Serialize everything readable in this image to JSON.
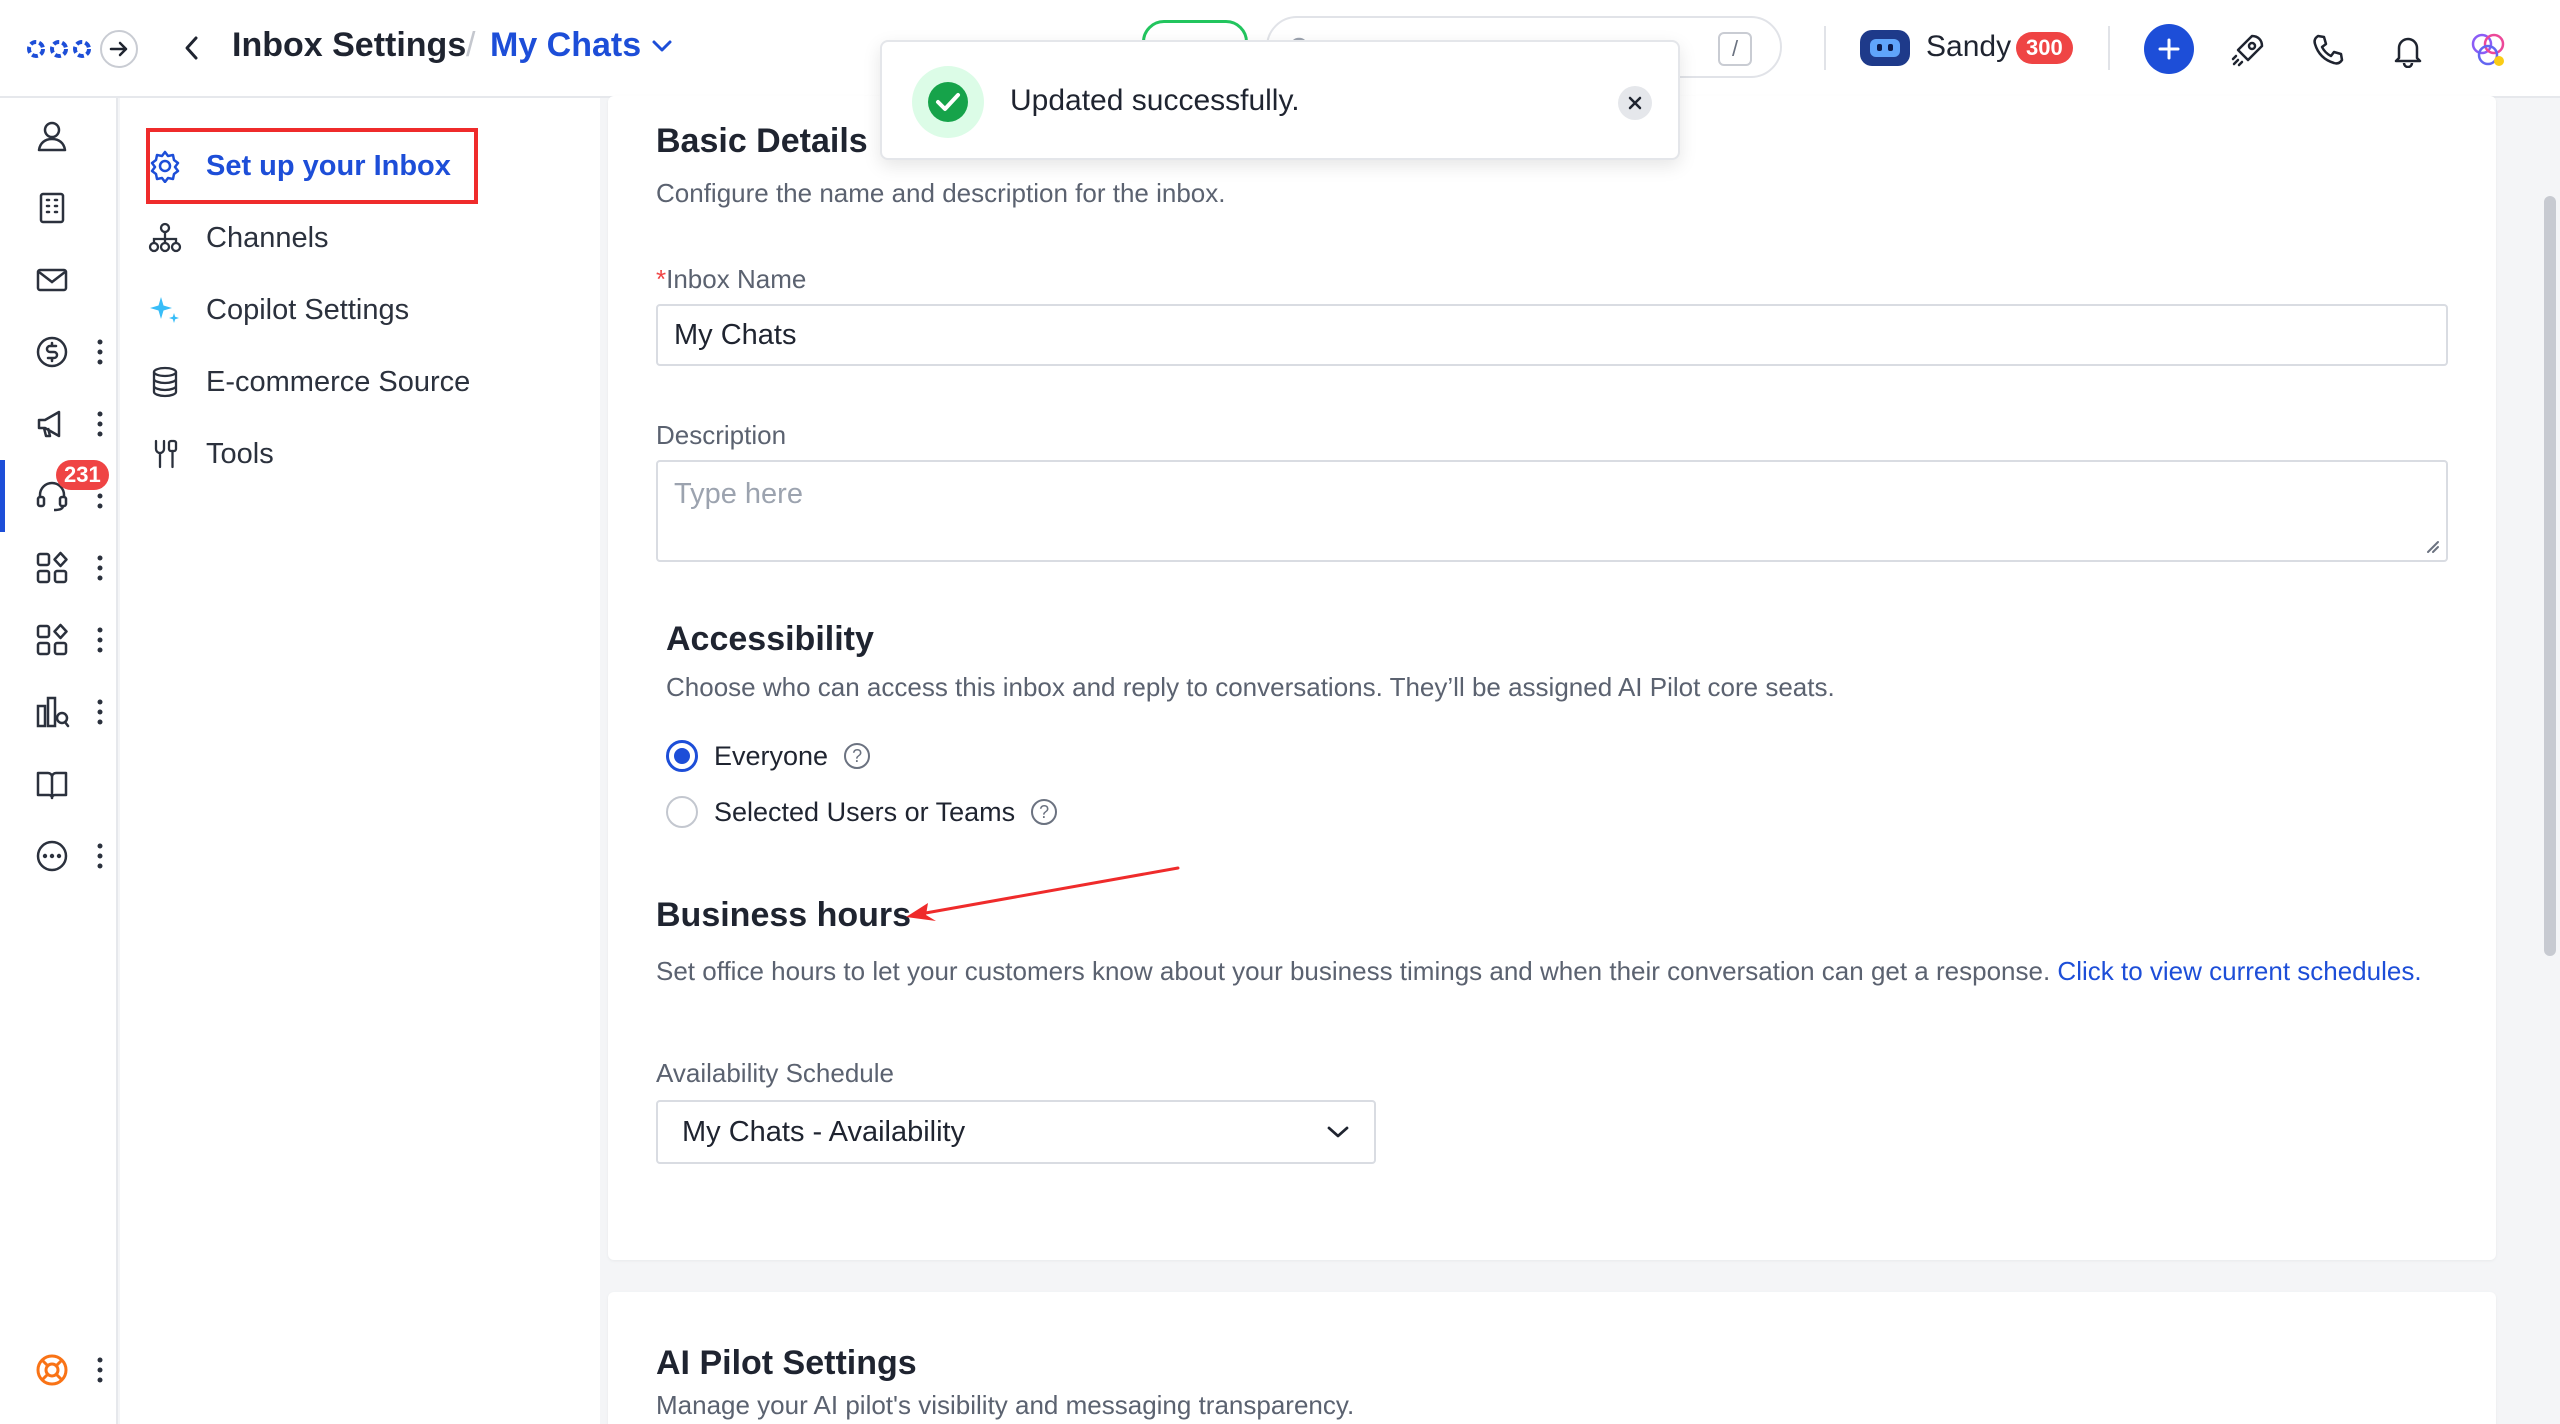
{
  "header": {
    "title": "Inbox Settings",
    "separator": "/",
    "current_inbox": "My Chats",
    "search_shortcut": "/",
    "user_name": "Sandy",
    "credits": "300"
  },
  "toast": {
    "message": "Updated successfully."
  },
  "rail": {
    "badge_count": "231"
  },
  "settings_nav": {
    "items": [
      {
        "label": "Set up your Inbox",
        "icon": "gear-icon"
      },
      {
        "label": "Channels",
        "icon": "channels-icon"
      },
      {
        "label": "Copilot Settings",
        "icon": "sparkle-icon"
      },
      {
        "label": "E-commerce Source",
        "icon": "database-icon"
      },
      {
        "label": "Tools",
        "icon": "tools-icon"
      }
    ]
  },
  "basic_details": {
    "title": "Basic Details",
    "description": "Configure the name and description for the inbox.",
    "inbox_name_required": "*",
    "inbox_name_label": "Inbox Name",
    "inbox_name_value": "My Chats",
    "description_label": "Description",
    "description_placeholder": "Type here"
  },
  "accessibility": {
    "title": "Accessibility",
    "description": "Choose who can access this inbox and reply to conversations. They’ll be assigned AI Pilot core seats.",
    "options": [
      {
        "label": "Everyone",
        "selected": true
      },
      {
        "label": "Selected Users or Teams",
        "selected": false
      }
    ],
    "help_glyph": "?"
  },
  "business_hours": {
    "title": "Business hours",
    "description": "Set office hours to let your customers know about your business timings and when their conversation can get a response.",
    "link_text": "Click to view current schedules.",
    "schedule_label": "Availability Schedule",
    "schedule_value": "My Chats - Availability"
  },
  "ai_pilot": {
    "title": "AI Pilot Settings",
    "description": "Manage your AI pilot's visibility and messaging transparency."
  },
  "colors": {
    "accent": "#1d4ed8",
    "danger": "#ef4444",
    "success": "#22c55e",
    "annotation": "#ef2b2b"
  }
}
